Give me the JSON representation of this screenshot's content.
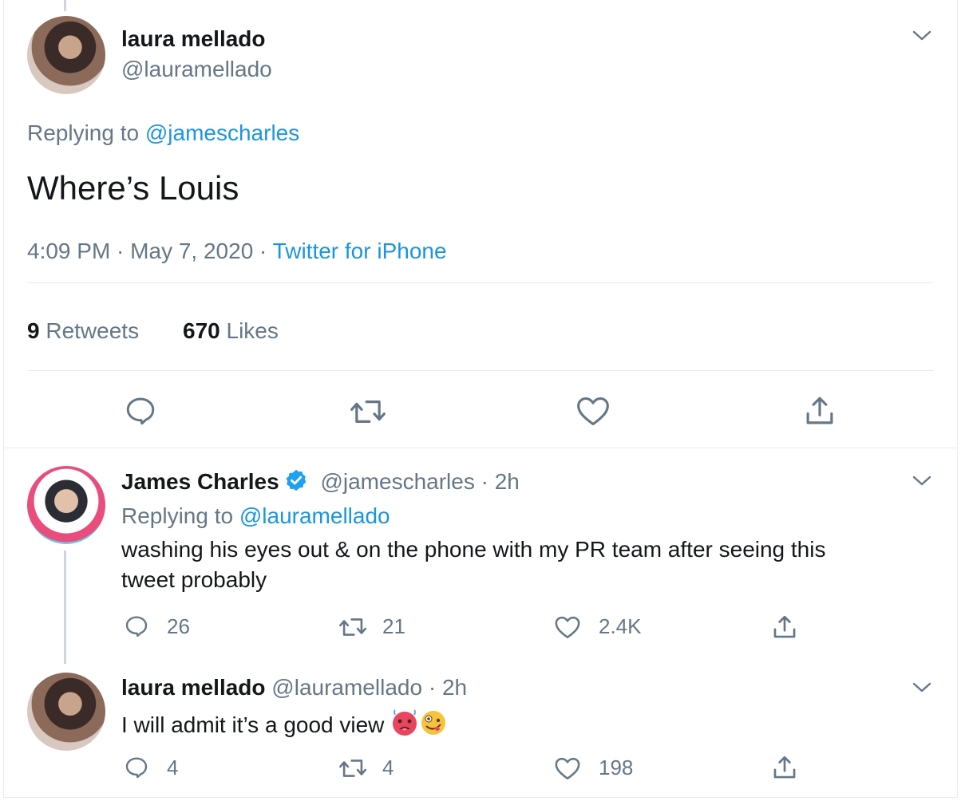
{
  "main_tweet": {
    "author_name": "laura mellado",
    "author_handle": "@lauramellado",
    "replying_prefix": "Replying to ",
    "replying_to": "@jamescharles",
    "text": "Where’s Louis",
    "time": "4:09 PM",
    "dot1": " · ",
    "date": "May 7, 2020",
    "dot2": " · ",
    "source": "Twitter for iPhone",
    "retweets_count": "9",
    "retweets_label": " Retweets",
    "likes_count": "670",
    "likes_label": " Likes"
  },
  "reply1": {
    "author_name": "James Charles",
    "author_handle": "@jamescharles",
    "dot": " · ",
    "time": "2h",
    "replying_prefix": "Replying to ",
    "replying_to": "@lauramellado",
    "text_line1": "washing his eyes out & on the phone with my PR team after seeing this",
    "text_line2": "tweet probably",
    "reply_count": "26",
    "retweet_count": "21",
    "like_count": "2.4K"
  },
  "reply2": {
    "author_name": "laura mellado",
    "author_handle": "@lauramellado",
    "dot": " · ",
    "time": "2h",
    "text": "I will admit it’s a good view",
    "reply_count": "4",
    "retweet_count": "4",
    "like_count": "198"
  },
  "icons": {
    "reply": "reply-icon",
    "retweet": "retweet-icon",
    "like": "heart-icon",
    "share": "share-icon",
    "more": "chevron-down-icon",
    "verified": "verified-badge-icon"
  },
  "colors": {
    "link": "#1b95e0",
    "muted": "#657786",
    "text": "#14171a",
    "border": "#e6ecf0"
  }
}
